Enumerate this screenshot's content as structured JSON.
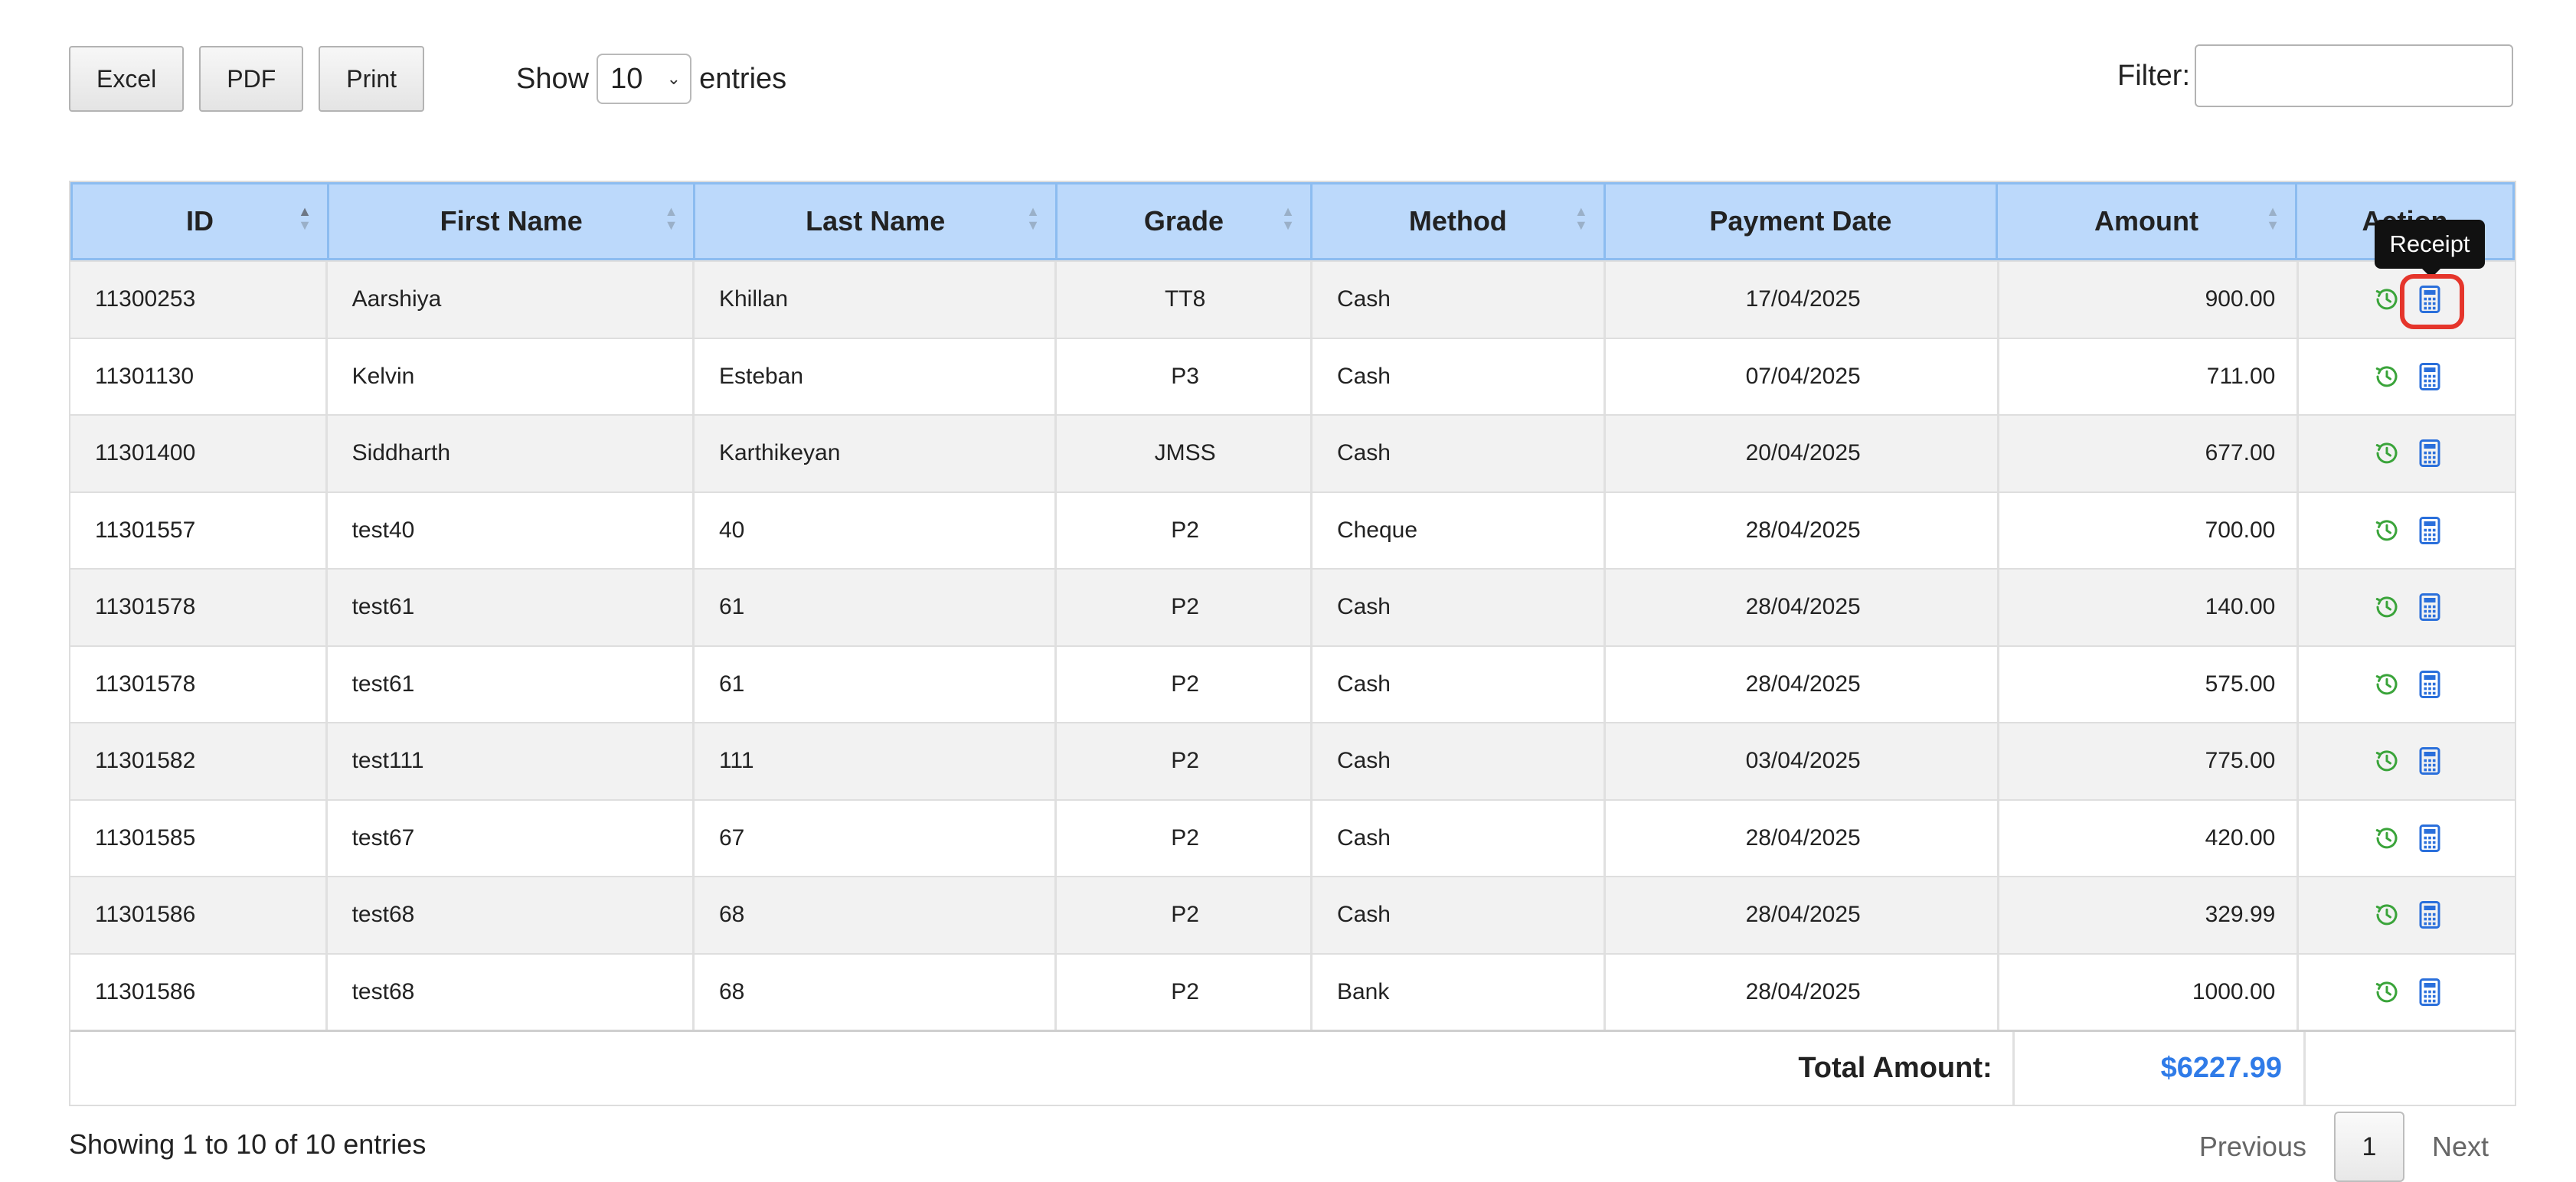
{
  "toolbar": {
    "buttons": [
      "Excel",
      "PDF",
      "Print"
    ],
    "show_label": "Show",
    "entries_value": "10",
    "entries_label": "entries",
    "filter_label": "Filter:",
    "filter_value": ""
  },
  "table": {
    "headers": [
      "ID",
      "First Name",
      "Last Name",
      "Grade",
      "Method",
      "Payment Date",
      "Amount",
      "Action"
    ],
    "rows": [
      {
        "id": "11300253",
        "first": "Aarshiya",
        "last": "Khillan",
        "grade": "TT8",
        "method": "Cash",
        "date": "17/04/2025",
        "amount": "900.00"
      },
      {
        "id": "11301130",
        "first": "Kelvin",
        "last": "Esteban",
        "grade": "P3",
        "method": "Cash",
        "date": "07/04/2025",
        "amount": "711.00"
      },
      {
        "id": "11301400",
        "first": "Siddharth",
        "last": "Karthikeyan",
        "grade": "JMSS",
        "method": "Cash",
        "date": "20/04/2025",
        "amount": "677.00"
      },
      {
        "id": "11301557",
        "first": "test40",
        "last": "40",
        "grade": "P2",
        "method": "Cheque",
        "date": "28/04/2025",
        "amount": "700.00"
      },
      {
        "id": "11301578",
        "first": "test61",
        "last": "61",
        "grade": "P2",
        "method": "Cash",
        "date": "28/04/2025",
        "amount": "140.00"
      },
      {
        "id": "11301578",
        "first": "test61",
        "last": "61",
        "grade": "P2",
        "method": "Cash",
        "date": "28/04/2025",
        "amount": "575.00"
      },
      {
        "id": "11301582",
        "first": "test111",
        "last": "111",
        "grade": "P2",
        "method": "Cash",
        "date": "03/04/2025",
        "amount": "775.00"
      },
      {
        "id": "11301585",
        "first": "test67",
        "last": "67",
        "grade": "P2",
        "method": "Cash",
        "date": "28/04/2025",
        "amount": "420.00"
      },
      {
        "id": "11301586",
        "first": "test68",
        "last": "68",
        "grade": "P2",
        "method": "Cash",
        "date": "28/04/2025",
        "amount": "329.99"
      },
      {
        "id": "11301586",
        "first": "test68",
        "last": "68",
        "grade": "P2",
        "method": "Bank",
        "date": "28/04/2025",
        "amount": "1000.00"
      }
    ],
    "total_label": "Total Amount:",
    "total_value": "$6227.99"
  },
  "action_icons": {
    "history": "clock-history-icon",
    "receipt": "calculator-receipt-icon"
  },
  "tooltip": {
    "text": "Receipt"
  },
  "colors": {
    "header_bg": "#bcd9fb",
    "header_border": "#8cbcf0",
    "total": "#2f7be8",
    "history_icon": "#3aa43a",
    "receipt_icon": "#2a6fdb",
    "highlight": "#e5352b"
  },
  "footer": {
    "info": "Showing 1 to 10 of 10 entries",
    "previous": "Previous",
    "page": "1",
    "next": "Next"
  }
}
